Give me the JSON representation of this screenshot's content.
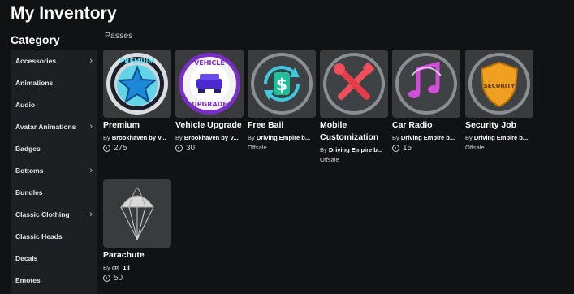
{
  "page": {
    "title": "My Inventory"
  },
  "sidebar": {
    "heading": "Category",
    "items": [
      {
        "label": "Accessories",
        "chevron": true
      },
      {
        "label": "Animations",
        "chevron": false
      },
      {
        "label": "Audio",
        "chevron": false
      },
      {
        "label": "Avatar Animations",
        "chevron": true
      },
      {
        "label": "Badges",
        "chevron": false
      },
      {
        "label": "Bottoms",
        "chevron": true
      },
      {
        "label": "Bundles",
        "chevron": false
      },
      {
        "label": "Classic Clothing",
        "chevron": true
      },
      {
        "label": "Classic Heads",
        "chevron": false
      },
      {
        "label": "Decals",
        "chevron": false
      },
      {
        "label": "Emotes",
        "chevron": false
      }
    ]
  },
  "main": {
    "section_label": "Passes",
    "items": [
      {
        "name": "Premium",
        "creator_prefix": "By",
        "creator": "Brookhaven by V...",
        "price": "275",
        "offsale": "",
        "icon": "premium-star-icon"
      },
      {
        "name": "Vehicle Upgrade",
        "creator_prefix": "By",
        "creator": "Brookhaven by V...",
        "price": "30",
        "offsale": "",
        "icon": "vehicle-upgrade-icon"
      },
      {
        "name": "Free Bail",
        "creator_prefix": "By",
        "creator": "Driving Empire b...",
        "price": "",
        "offsale": "Offsale",
        "icon": "dollar-refresh-icon"
      },
      {
        "name": "Mobile Customization",
        "creator_prefix": "By",
        "creator": "Driving Empire b...",
        "price": "",
        "offsale": "Offsale",
        "icon": "wrench-brush-icon"
      },
      {
        "name": "Car Radio",
        "creator_prefix": "By",
        "creator": "Driving Empire b...",
        "price": "15",
        "offsale": "",
        "icon": "music-note-icon"
      },
      {
        "name": "Security Job",
        "creator_prefix": "By",
        "creator": "Driving Empire b...",
        "price": "",
        "offsale": "Offsale",
        "icon": "security-badge-icon",
        "badge_text": "SECURITY"
      },
      {
        "name": "Parachute",
        "creator_prefix": "By",
        "creator": "@i_1ll",
        "price": "50",
        "offsale": "",
        "icon": "parachute-icon"
      }
    ],
    "badge_texts": {
      "premium": "PREMIUM",
      "vehicle_top": "VEHICLE",
      "vehicle_bottom": "UPGRADE",
      "security": "SECURITY"
    }
  },
  "colors": {
    "background": "#111214",
    "sidebar": "#1e1f22",
    "card": "#393b3d",
    "text": "#ffffff",
    "muted": "#cfcfcf"
  }
}
